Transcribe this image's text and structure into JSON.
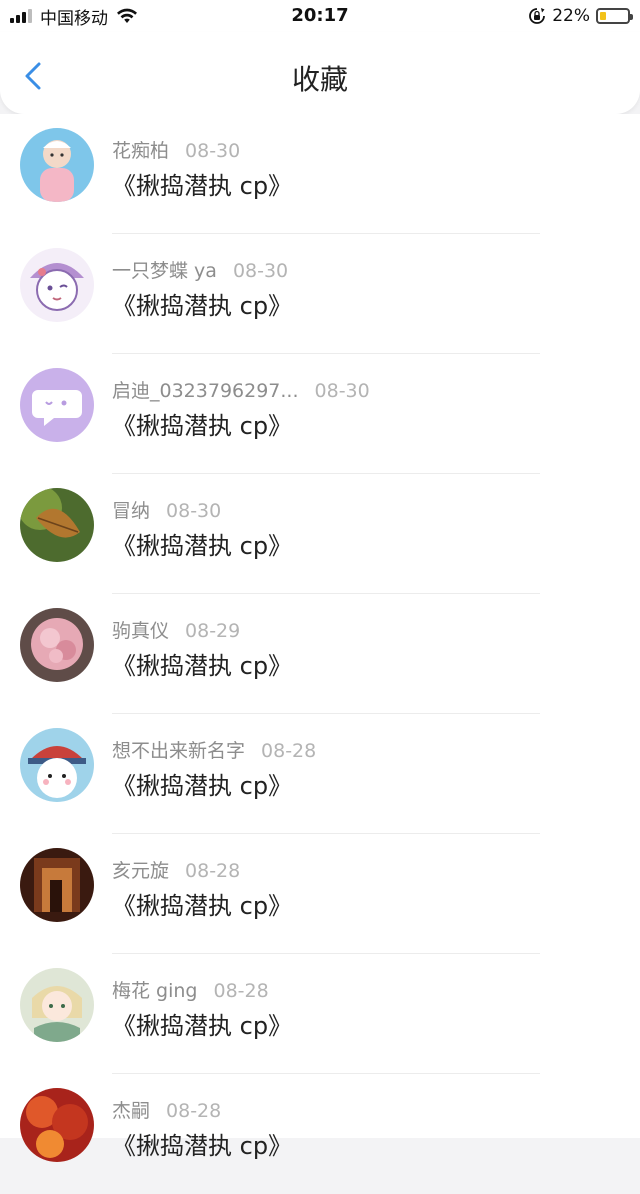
{
  "status_bar": {
    "carrier": "中国移动",
    "time": "20:17",
    "battery_percent": "22%",
    "battery_level": 0.22,
    "battery_color": "#f2c21a"
  },
  "nav": {
    "title": "收藏",
    "back_icon": "chevron-left-icon",
    "accent": "#3a8ee6"
  },
  "items": [
    {
      "name": "花痴柏",
      "date": "08-30",
      "title": "《揪捣潜执 cp》"
    },
    {
      "name": "一只梦蝶 ya",
      "date": "08-30",
      "title": "《揪捣潜执 cp》"
    },
    {
      "name": "启迪_0323796297...",
      "date": "08-30",
      "title": "《揪捣潜执 cp》"
    },
    {
      "name": "冒纳",
      "date": "08-30",
      "title": "《揪捣潜执 cp》"
    },
    {
      "name": "驹真仪",
      "date": "08-29",
      "title": "《揪捣潜执 cp》"
    },
    {
      "name": "想不出来新名字",
      "date": "08-28",
      "title": "《揪捣潜执 cp》"
    },
    {
      "name": "亥元旋",
      "date": "08-28",
      "title": "《揪捣潜执 cp》"
    },
    {
      "name": "梅花 ging",
      "date": "08-28",
      "title": "《揪捣潜执 cp》"
    },
    {
      "name": "杰嗣",
      "date": "08-28",
      "title": "《揪捣潜执 cp》"
    }
  ]
}
